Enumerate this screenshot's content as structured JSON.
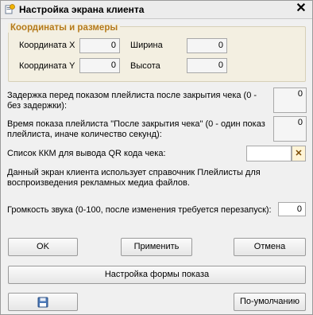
{
  "window": {
    "title": "Настройка экрана клиента"
  },
  "group": {
    "title": "Координаты и размеры",
    "x_label": "Координата X",
    "x_value": "0",
    "y_label": "Координата Y",
    "y_value": "0",
    "w_label": "Ширина",
    "w_value": "0",
    "h_label": "Высота",
    "h_value": "0"
  },
  "delay": {
    "label": "Задержка перед показом плейлиста после закрытия чека (0 - без задержки):",
    "value": "0"
  },
  "duration": {
    "label": "Время показа плейлиста \"После закрытия чека\" (0 - один показ плейлиста, иначе количество секунд):",
    "value": "0"
  },
  "qr": {
    "label": "Список ККМ для вывода QR кода чека:",
    "value": "",
    "clear_symbol": "✕"
  },
  "info": {
    "text": "Данный экран клиента использует справочник Плейлисты для воспроизведения рекламных медиа файлов."
  },
  "volume": {
    "label": "Громкость звука (0-100, после изменения требуется перезапуск):",
    "value": "0"
  },
  "buttons": {
    "ok": "OK",
    "apply": "Применить",
    "cancel": "Отмена",
    "form_settings": "Настройка формы показа",
    "default": "По-умолчанию"
  },
  "icons": {
    "app": "settings-app-icon",
    "save": "floppy-disk-icon",
    "close": "close-icon"
  }
}
